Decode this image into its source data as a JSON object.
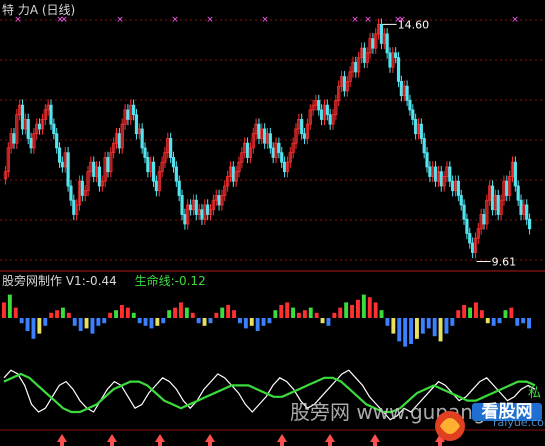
{
  "header": {
    "title": "特  力A (日线)"
  },
  "indicator": {
    "label": "股旁网制作",
    "v1_label": "V1:-0.44",
    "life_label": "生命线:-0.12"
  },
  "watermark": {
    "text": "股旁网  www.gupang.com",
    "site": "raiyue.com"
  },
  "logo": {
    "text": "看股网"
  },
  "side_label": "私",
  "colors": {
    "up": "#ff3030",
    "down": "#54e4f0",
    "grid": "#8a0f0f",
    "divider": "#b01818",
    "white_line": "#ffffff",
    "green_line": "#3cdc3c",
    "pos_bar": "#ff3030",
    "pos_bar_alt": "#3cdc3c",
    "neg_bar": "#3a80ff",
    "neg_bar_alt": "#e8e060",
    "marker": "#ff60ff",
    "arrow": "#ff5050"
  },
  "chart_data": [
    {
      "type": "candlestick",
      "annotations": [
        {
          "label": "14.60",
          "value": 14.6
        },
        {
          "label": "9.61",
          "value": 9.61
        }
      ],
      "closes": [
        11.5,
        12.0,
        12.3,
        12.1,
        12.7,
        12.9,
        12.4,
        12.6,
        12.2,
        12.0,
        12.3,
        12.5,
        12.4,
        12.6,
        12.8,
        12.9,
        12.5,
        12.3,
        12.0,
        11.7,
        11.6,
        11.9,
        11.2,
        10.9,
        10.6,
        10.8,
        11.3,
        11.0,
        11.1,
        11.5,
        11.7,
        11.4,
        11.6,
        11.2,
        11.3,
        11.8,
        11.5,
        11.9,
        12.1,
        12.3,
        12.0,
        12.5,
        12.8,
        12.6,
        12.9,
        12.7,
        12.3,
        12.4,
        12.0,
        11.8,
        11.5,
        11.7,
        11.3,
        11.1,
        11.5,
        11.7,
        11.9,
        12.2,
        11.8,
        11.6,
        11.3,
        11.0,
        10.6,
        10.4,
        10.8,
        10.7,
        10.9,
        10.6,
        10.7,
        10.5,
        10.8,
        10.6,
        10.7,
        10.9,
        11.0,
        10.8,
        11.0,
        11.2,
        11.4,
        11.6,
        11.3,
        11.5,
        11.7,
        11.9,
        12.1,
        11.8,
        12.0,
        12.3,
        12.5,
        12.2,
        12.4,
        12.1,
        12.3,
        12.0,
        11.8,
        12.1,
        11.9,
        11.7,
        11.5,
        11.7,
        11.9,
        12.1,
        12.4,
        12.6,
        12.3,
        12.2,
        12.5,
        12.8,
        12.9,
        13.0,
        12.8,
        12.6,
        12.9,
        12.7,
        12.5,
        12.7,
        13.0,
        13.3,
        13.5,
        13.2,
        13.4,
        13.6,
        13.8,
        13.6,
        13.9,
        14.1,
        13.8,
        14.0,
        14.3,
        14.1,
        14.4,
        14.6,
        14.2,
        14.4,
        14.0,
        13.7,
        14.0,
        13.9,
        13.4,
        13.1,
        13.3,
        13.0,
        12.8,
        12.6,
        12.3,
        12.5,
        12.2,
        11.9,
        11.6,
        11.4,
        11.6,
        11.3,
        11.5,
        11.2,
        11.4,
        11.6,
        11.3,
        11.1,
        11.3,
        11.0,
        10.8,
        10.5,
        10.2,
        10.0,
        9.8,
        10.1,
        10.3,
        10.6,
        10.4,
        10.9,
        11.2,
        10.7,
        11.0,
        10.6,
        10.9,
        11.3,
        11.0,
        11.4,
        11.7,
        11.2,
        10.9,
        10.6,
        10.8,
        10.5,
        10.3
      ]
    },
    {
      "type": "bar",
      "name": "V1",
      "values": [
        0.6,
        0.9,
        0.4,
        -0.2,
        -0.5,
        -0.8,
        -0.6,
        -0.3,
        0.2,
        0.3,
        0.4,
        0.2,
        -0.3,
        -0.5,
        -0.4,
        -0.6,
        -0.3,
        -0.2,
        0.2,
        0.3,
        0.5,
        0.4,
        0.2,
        -0.2,
        -0.3,
        -0.4,
        -0.3,
        -0.2,
        0.3,
        0.4,
        0.6,
        0.4,
        0.2,
        -0.2,
        -0.3,
        -0.2,
        0.2,
        0.4,
        0.5,
        0.3,
        -0.2,
        -0.4,
        -0.3,
        -0.5,
        -0.3,
        -0.2,
        0.3,
        0.5,
        0.6,
        0.4,
        0.2,
        0.3,
        0.4,
        0.2,
        -0.2,
        -0.3,
        0.2,
        0.4,
        0.6,
        0.5,
        0.7,
        0.9,
        0.8,
        0.6,
        0.3,
        -0.3,
        -0.6,
        -0.9,
        -1.1,
        -1.0,
        -0.8,
        -0.6,
        -0.4,
        -0.7,
        -0.9,
        -0.6,
        -0.3,
        0.3,
        0.5,
        0.4,
        0.6,
        0.3,
        -0.2,
        -0.3,
        -0.2,
        0.3,
        0.4,
        -0.3,
        -0.2,
        -0.4
      ]
    },
    {
      "type": "line",
      "series": [
        {
          "name": "",
          "values": [
            0.4,
            0.6,
            0.5,
            0.2,
            -0.3,
            -0.5,
            -0.4,
            -0.1,
            0.2,
            0.3,
            0.1,
            -0.2,
            -0.4,
            -0.5,
            -0.2,
            0.1,
            0.3,
            0.2,
            -0.1,
            -0.4,
            -0.3,
            0.0,
            0.2,
            0.4,
            0.3,
            0.1,
            -0.2,
            -0.4,
            -0.2,
            0.1,
            0.3,
            0.5,
            0.4,
            0.2,
            0.0,
            -0.3,
            -0.5,
            -0.3,
            -0.1,
            0.2,
            0.4,
            0.3,
            0.1,
            -0.2,
            -0.4,
            -0.3,
            -0.1,
            0.1,
            0.3,
            0.5,
            0.6,
            0.4,
            0.2,
            -0.1,
            -0.3,
            -0.5,
            -0.7,
            -0.6,
            -0.4,
            -0.5,
            -0.3,
            -0.1,
            0.1,
            0.3,
            0.2,
            0.0,
            -0.2,
            -0.1,
            0.1,
            0.3,
            0.4,
            0.2,
            0.0,
            -0.2,
            -0.1,
            0.1,
            0.2,
            0.1
          ]
        },
        {
          "name": "",
          "values": [
            0.3,
            0.4,
            0.5,
            0.4,
            0.2,
            0.0,
            -0.2,
            -0.4,
            -0.5,
            -0.5,
            -0.4,
            -0.3,
            -0.1,
            0.1,
            0.2,
            0.3,
            0.3,
            0.2,
            0.0,
            -0.2,
            -0.3,
            -0.4,
            -0.3,
            -0.2,
            -0.1,
            0.0,
            0.1,
            0.2,
            0.2,
            0.2,
            0.1,
            0.0,
            -0.1,
            -0.1,
            0.0,
            0.1,
            0.2,
            0.3,
            0.4,
            0.4,
            0.3,
            0.1,
            -0.1,
            -0.3,
            -0.4,
            -0.5,
            -0.5,
            -0.4,
            -0.2,
            0.0,
            0.1,
            0.2,
            0.1,
            0.0,
            -0.1,
            -0.2,
            -0.2,
            -0.1,
            0.0,
            0.1,
            0.2,
            0.3,
            0.3,
            0.2
          ]
        }
      ]
    }
  ]
}
